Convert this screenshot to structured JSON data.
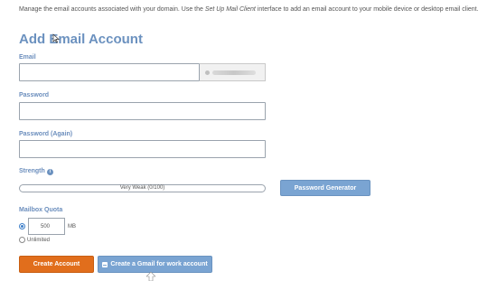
{
  "intro": {
    "before": "Manage the email accounts associated with your domain. Use the ",
    "link": "Set Up Mail Client",
    "after": " interface to add an email account to your mobile device or desktop email client."
  },
  "form": {
    "title": "Add Email Account",
    "email_label": "Email",
    "email_value": "",
    "password_label": "Password",
    "password_again_label": "Password (Again)",
    "strength_label": "Strength",
    "strength_value": "Very Weak (0/100)",
    "password_generator_label": "Password Generator",
    "mailbox_quota_label": "Mailbox Quota",
    "quota_value": "500",
    "quota_unit": "MB",
    "unlimited_label": "Unlimited",
    "quota_mode": "limited",
    "create_account_label": "Create Account",
    "gmail_button_label": "Create a Gmail for work account"
  },
  "icons": {
    "info": "info-icon",
    "gmail": "mail-icon",
    "cursor": "pointer-cursor-icon"
  },
  "colors": {
    "accent": "#6b91bf",
    "primary_button": "#e16e1c",
    "secondary_button": "#7aa4d2"
  }
}
